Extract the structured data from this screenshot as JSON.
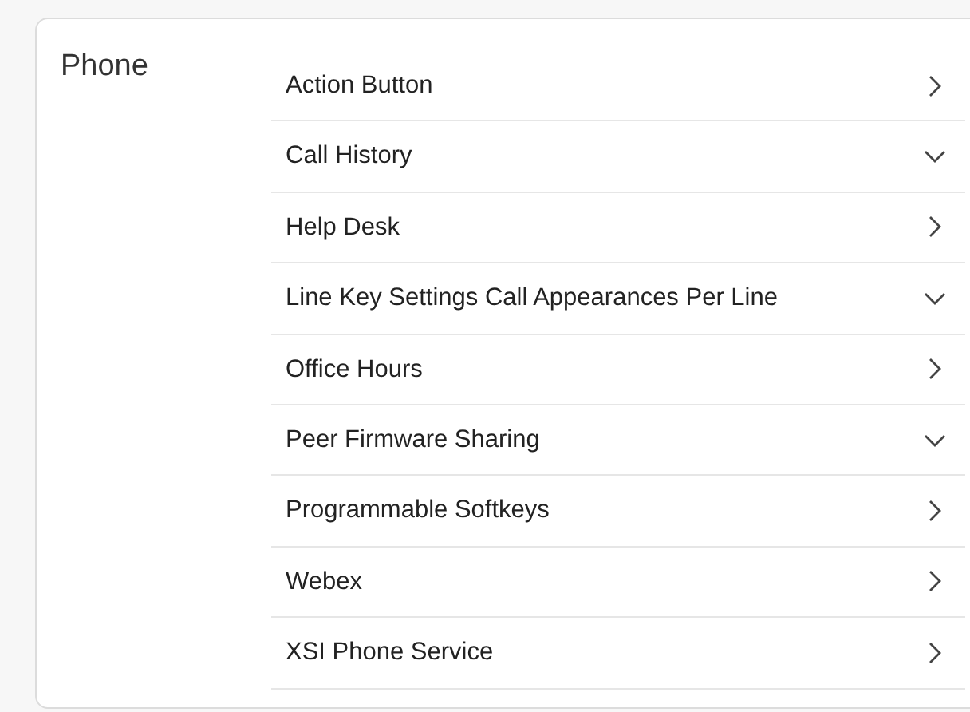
{
  "section": {
    "title": "Phone"
  },
  "items": [
    {
      "label": "Action Button",
      "expanded": false
    },
    {
      "label": "Call History",
      "expanded": true
    },
    {
      "label": "Help Desk",
      "expanded": false
    },
    {
      "label": "Line Key Settings Call Appearances Per Line",
      "expanded": true
    },
    {
      "label": "Office Hours",
      "expanded": false
    },
    {
      "label": "Peer Firmware Sharing",
      "expanded": true
    },
    {
      "label": "Programmable Softkeys",
      "expanded": false
    },
    {
      "label": "Webex",
      "expanded": false
    },
    {
      "label": "XSI Phone Service",
      "expanded": false
    }
  ]
}
